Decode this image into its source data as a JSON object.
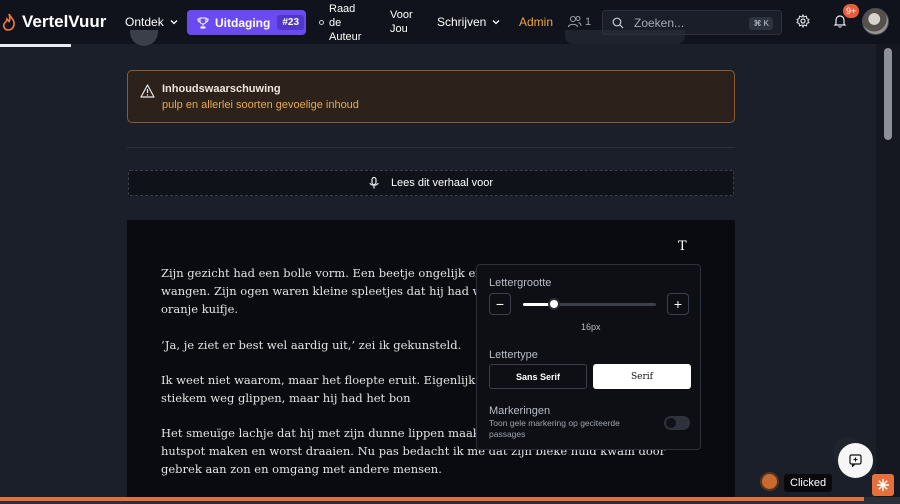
{
  "nav": {
    "brand": "VertelVuur",
    "ontdek": "Ontdek",
    "challenge_label": "Uitdaging",
    "challenge_number": "#23",
    "raad": "Raad de Auteur",
    "voor_jou": "Voor Jou",
    "schrijven": "Schrijven",
    "admin": "Admin",
    "friends_count": "1",
    "search_placeholder": "Zoeken...",
    "search_shortcut": "⌘ K",
    "notifications_badge": "9+",
    "accent": "#6a4bf2",
    "admin_color": "#f0a642"
  },
  "warning": {
    "title": "Inhoudswaarschuwing",
    "description": "pulp en allerlei soorten gevoelige inhoud",
    "icon": "warning-triangle-icon"
  },
  "read_aloud": {
    "label": "Lees dit verhaal voor",
    "icon": "microphone-icon"
  },
  "story": {
    "text_settings_glyph": "T",
    "paragraphs": [
      "Zijn gezicht had een bolle vorm. Een beetje ongelijk en ingedeukt met van die knobbelige wangen. Zijn ogen waren kleine spleetjes dat hij had waren stekeltjes met een klein oranje kuifje.",
      "‘Ja, je ziet er best wel aardig uit,’ zei ik gekunsteld.",
      "Ik weet niet waarom, maar het floepte eruit. Eigenlijk zocht ik n wc gaan ofzo, en dan stiekem weg glippen, maar hij had het bon",
      "Het smeuïge lachje dat hij met zijn dunne lippen maakte veront Zijn hobby's waren hutspot maken en worst draaien. Nu pas bedacht ik me dat zijn bleke huid kwam door gebrek aan zon en omgang met andere mensen."
    ]
  },
  "settings": {
    "font_size_label": "Lettergrootte",
    "font_size_value": "16px",
    "font_size_fraction": 0.23,
    "minus": "−",
    "plus": "+",
    "font_type_label": "Lettertype",
    "font_sans": "Sans Serif",
    "font_serif": "Serif",
    "selected_font": "Serif",
    "markings_label": "Markeringen",
    "markings_desc": "Toon gele markering op geciteerde passages",
    "markings_enabled": false
  },
  "tooltip": "Clicked",
  "reading_progress": 0.96
}
